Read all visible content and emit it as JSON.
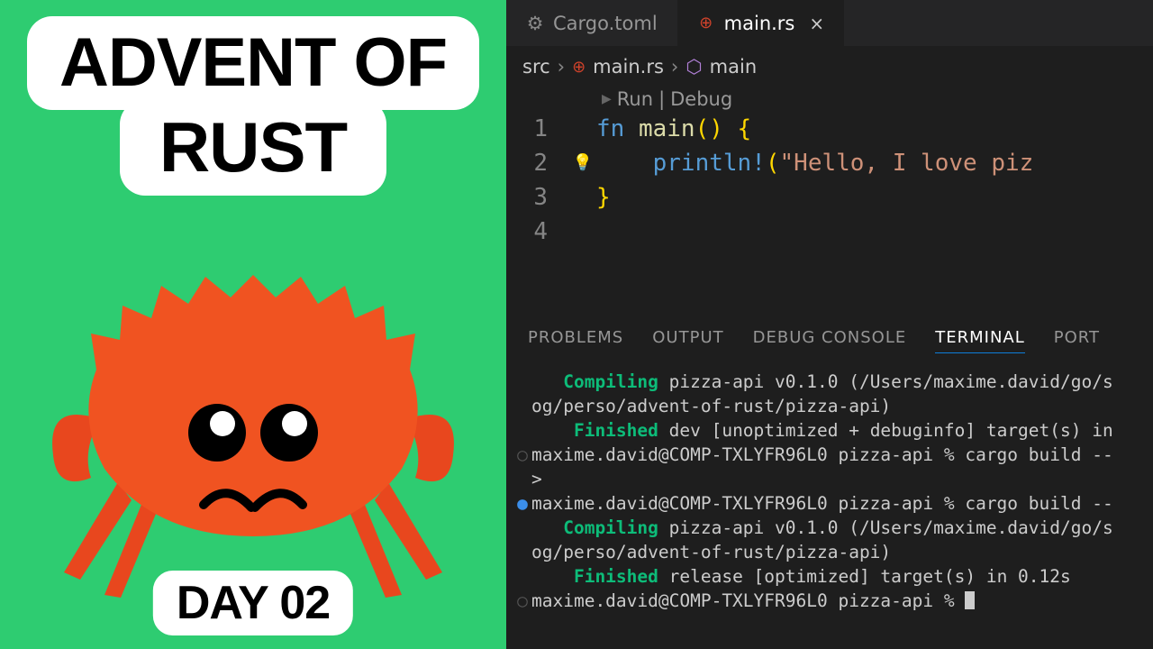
{
  "left": {
    "title1": "ADVENT OF",
    "title2": "RUST",
    "day": "DAY 02"
  },
  "tabs": {
    "cargo": "Cargo.toml",
    "main": "main.rs"
  },
  "breadcrumb": {
    "src": "src",
    "file": "main.rs",
    "fn": "main"
  },
  "codelens": {
    "run": "Run",
    "debug": "Debug"
  },
  "code": {
    "l1": {
      "num": "1",
      "kw": "fn",
      "name": "main",
      "parens": "()",
      "brace": " {"
    },
    "l2": {
      "num": "2",
      "indent": "    ",
      "macro": "println!",
      "open": "(",
      "str": "\"Hello, I love piz"
    },
    "l3": {
      "num": "3",
      "brace": "}"
    },
    "l4": {
      "num": "4"
    }
  },
  "panelTabs": {
    "problems": "PROBLEMS",
    "output": "OUTPUT",
    "debug": "DEBUG CONSOLE",
    "terminal": "TERMINAL",
    "ports": "PORT"
  },
  "terminal": [
    {
      "mark": "",
      "segs": [
        {
          "c": "green",
          "t": "   Compiling"
        },
        {
          "t": " pizza-api v0.1.0 (/Users/maxime.david/go/s"
        }
      ]
    },
    {
      "mark": "",
      "segs": [
        {
          "t": "og/perso/advent-of-rust/pizza-api)"
        }
      ]
    },
    {
      "mark": "",
      "segs": [
        {
          "c": "green",
          "t": "    Finished"
        },
        {
          "t": " dev [unoptimized + debuginfo] target(s) in"
        }
      ]
    },
    {
      "mark": "○",
      "mc": "dot-empty",
      "segs": [
        {
          "t": "maxime.david@COMP-TXLYFR96L0 pizza-api % cargo build --"
        }
      ]
    },
    {
      "mark": "",
      "segs": [
        {
          "t": ">"
        }
      ]
    },
    {
      "mark": "●",
      "mc": "dot-blue",
      "segs": [
        {
          "t": "maxime.david@COMP-TXLYFR96L0 pizza-api % cargo build --"
        }
      ]
    },
    {
      "mark": "",
      "segs": [
        {
          "c": "green",
          "t": "   Compiling"
        },
        {
          "t": " pizza-api v0.1.0 (/Users/maxime.david/go/s"
        }
      ]
    },
    {
      "mark": "",
      "segs": [
        {
          "t": "og/perso/advent-of-rust/pizza-api)"
        }
      ]
    },
    {
      "mark": "",
      "segs": [
        {
          "c": "green",
          "t": "    Finished"
        },
        {
          "t": " release [optimized] target(s) in 0.12s"
        }
      ]
    },
    {
      "mark": "○",
      "mc": "dot-empty",
      "segs": [
        {
          "t": "maxime.david@COMP-TXLYFR96L0 pizza-api % "
        }
      ],
      "cursor": true
    }
  ]
}
